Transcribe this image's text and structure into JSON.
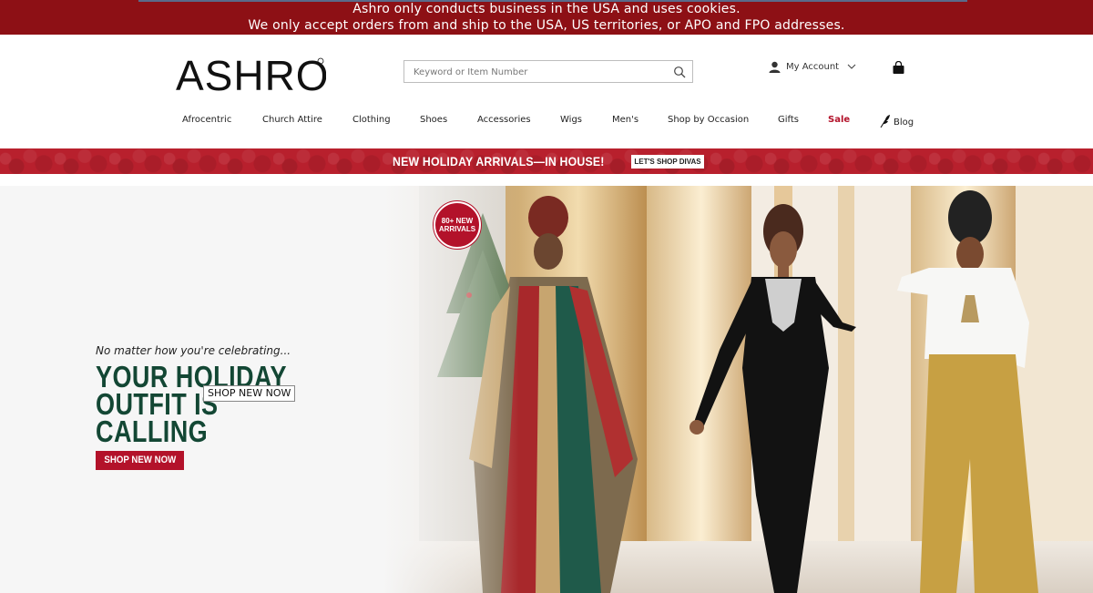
{
  "notice": {
    "line1": "Ashro only conducts business in the USA and uses cookies.",
    "line2": "We only accept orders from and ship to the USA, US territories, or APO and FPO addresses.",
    "color": "#8d1015"
  },
  "header": {
    "logo_text": "ASHRO",
    "search_placeholder": "Keyword or Item Number",
    "account_label": "My Account"
  },
  "nav": {
    "items": [
      {
        "label": "Afrocentric"
      },
      {
        "label": "Church Attire"
      },
      {
        "label": "Clothing"
      },
      {
        "label": "Shoes"
      },
      {
        "label": "Accessories"
      },
      {
        "label": "Wigs"
      },
      {
        "label": "Men's"
      },
      {
        "label": "Shop by Occasion"
      },
      {
        "label": "Gifts"
      },
      {
        "label": "Sale"
      },
      {
        "label": "Blog"
      }
    ]
  },
  "promo": {
    "text": "NEW HOLIDAY ARRIVALS—IN HOUSE!",
    "button": "LET'S SHOP DIVAS"
  },
  "hero": {
    "badge_line1": "80+ NEW",
    "badge_line2": "ARRIVALS",
    "tagline": "No matter how you're celebrating...",
    "headline_line1": "YOUR HOLIDAY",
    "headline_line2": "OUTFIT IS",
    "headline_line3": "CALLING",
    "tooltip": "SHOP NEW NOW",
    "button": "SHOP NEW NOW",
    "accent_color": "#b3122a",
    "headline_color": "#134734"
  }
}
